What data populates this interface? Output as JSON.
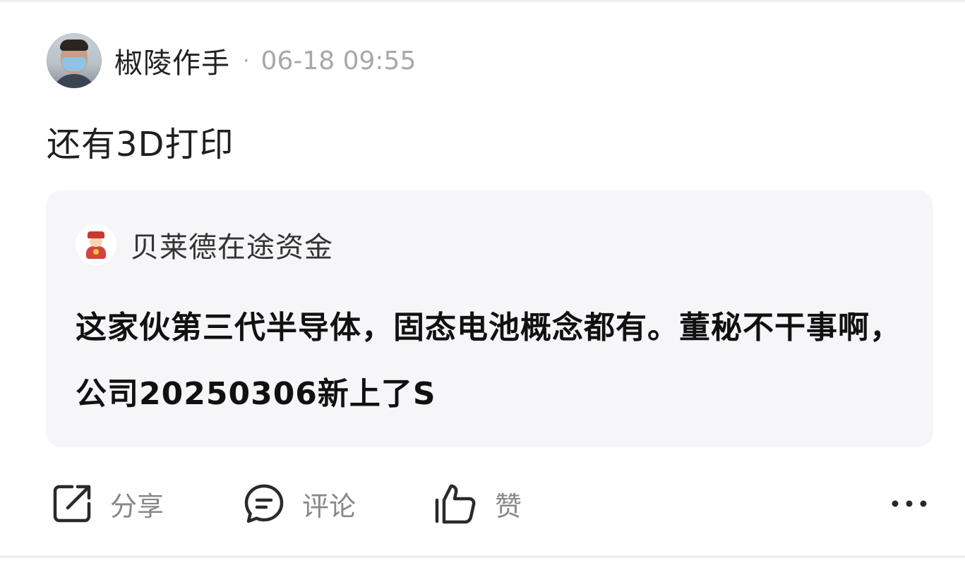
{
  "post": {
    "author": "椒陵作手",
    "separator": "·",
    "time": "06-18 09:55",
    "text": "还有3D打印"
  },
  "quote": {
    "author": "贝莱德在途资金",
    "text": "这家伙第三代半导体，固态电池概念都有。董秘不干事啊，公司20250306新上了S"
  },
  "actions": {
    "share_label": "分享",
    "comment_label": "评论",
    "like_label": "赞"
  },
  "icons": {
    "share": "share-icon",
    "comment": "comment-icon",
    "like": "thumbs-up-icon",
    "more": "more-dots-icon"
  }
}
